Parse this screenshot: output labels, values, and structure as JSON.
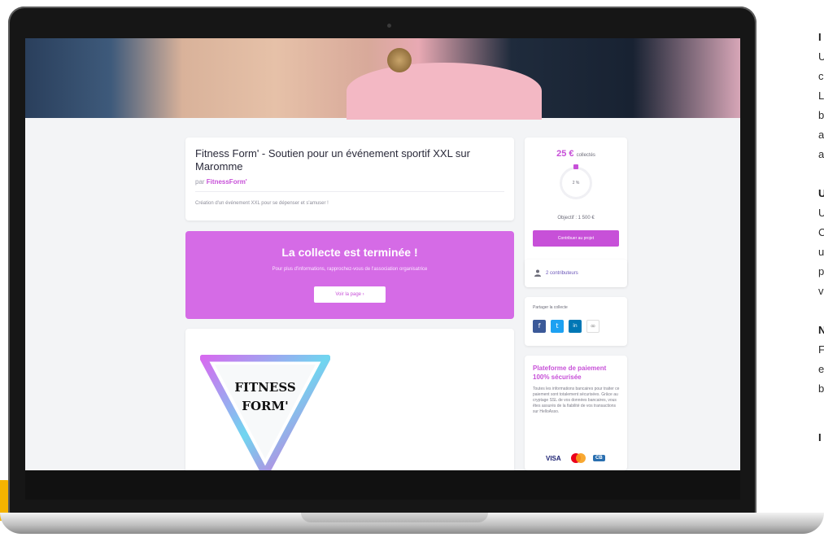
{
  "campaign": {
    "title": "Fitness Form' - Soutien pour un événement sportif XXL sur Maromme",
    "by_prefix": "par",
    "organizer": "FitnessForm'",
    "description": "Création d'un événement XXL pour se dépenser et s'amuser !"
  },
  "ended": {
    "title": "La collecte est terminée !",
    "subtitle": "Pour plus d'informations, rapprochez-vous de l'association organisatrice",
    "button": "Voir la page  ›"
  },
  "logo": {
    "line1": "FITNESS",
    "line2": "FORM'"
  },
  "stats": {
    "amount": "25 €",
    "collected_label": "collectés",
    "percent": "2 %",
    "progress_fraction": 0.02,
    "goal": "Objectif : 1 500 €",
    "cta": "Contribuer au projet",
    "contributors": "2 contributeurs"
  },
  "share": {
    "label": "Partager la collecte",
    "buttons": [
      {
        "icon": "facebook-icon",
        "glyph": "f",
        "color": "#3b5998"
      },
      {
        "icon": "twitter-icon",
        "glyph": "t",
        "color": "#1da1f2"
      },
      {
        "icon": "linkedin-icon",
        "glyph": "in",
        "color": "#0077b5"
      },
      {
        "icon": "link-icon",
        "glyph": "∞",
        "color": "#ffffff"
      }
    ]
  },
  "secure": {
    "title": "Plateforme de paiement 100% sécurisée",
    "text": "Toutes les informations bancaires pour traiter ce paiement sont totalement sécurisées. Grâce au cryptage SSL de vos données bancaires, vous êtes assurés de la fiabilité de vos transactions sur HelloAsso.",
    "payments": [
      "VISA",
      "mastercard",
      "CB"
    ]
  },
  "side_text": [
    "U",
    "c",
    "L",
    "b",
    "a",
    "a",
    "U",
    "C",
    "u",
    "p",
    "v",
    "F",
    "e",
    "b"
  ],
  "side_bold": [
    "I",
    "U",
    "N",
    "I"
  ]
}
